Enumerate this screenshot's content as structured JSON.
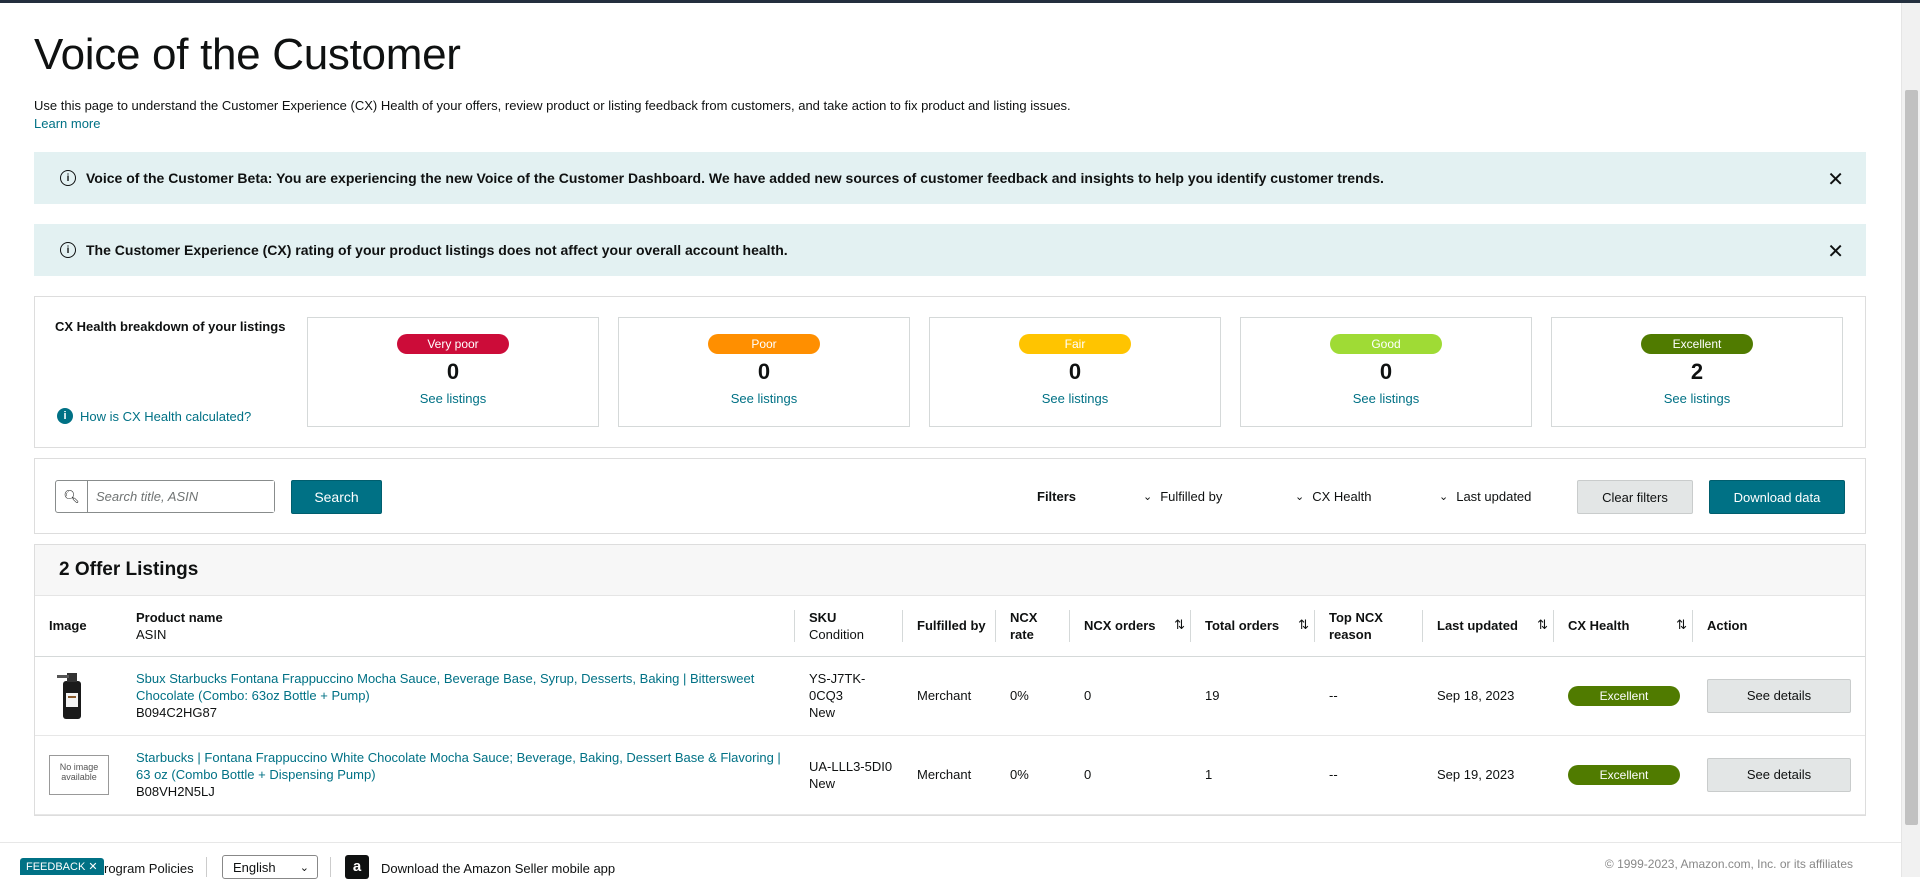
{
  "header": {
    "title": "Voice of the Customer",
    "intro": "Use this page to understand the Customer Experience (CX) Health of your offers, review product or listing feedback from customers, and take action to fix product and listing issues.",
    "learn_more": "Learn more"
  },
  "alerts": [
    {
      "text": "Voice of the Customer Beta: You are experiencing the new Voice of the Customer Dashboard. We have added new sources of customer feedback and insights to help you identify customer trends."
    },
    {
      "text": "The Customer Experience (CX) rating of your product listings does not affect your overall account health."
    }
  ],
  "cx_health": {
    "title": "CX Health breakdown of your listings",
    "help_link": "How is CX Health calculated?",
    "cards": [
      {
        "label": "Very poor",
        "count": "0",
        "link": "See listings",
        "color": "#cc0c39"
      },
      {
        "label": "Poor",
        "count": "0",
        "link": "See listings",
        "color": "#ff8f00"
      },
      {
        "label": "Fair",
        "count": "0",
        "link": "See listings",
        "color": "#ffc400"
      },
      {
        "label": "Good",
        "count": "0",
        "link": "See listings",
        "color": "#9fdb35"
      },
      {
        "label": "Excellent",
        "count": "2",
        "link": "See listings",
        "color": "#507b00"
      }
    ]
  },
  "toolbar": {
    "search_placeholder": "Search title, ASIN",
    "search_button": "Search",
    "filters_label": "Filters",
    "filter_fulfilled": "Fulfilled by",
    "filter_cx": "CX Health",
    "filter_updated": "Last updated",
    "clear_filters": "Clear filters",
    "download": "Download data"
  },
  "listings": {
    "heading": "2 Offer Listings",
    "columns": {
      "image": "Image",
      "product_name": "Product name",
      "asin": "ASIN",
      "sku": "SKU",
      "condition": "Condition",
      "fulfilled_by": "Fulfilled by",
      "ncx_rate": "NCX rate",
      "ncx_orders": "NCX orders",
      "total_orders": "Total orders",
      "top_ncx_1": "Top NCX",
      "top_ncx_2": "reason",
      "last_updated": "Last updated",
      "cx_health": "CX Health",
      "action": "Action"
    },
    "rows": [
      {
        "image_text": "",
        "product_name": "Sbux Starbucks Fontana Frappuccino Mocha Sauce, Beverage Base, Syrup, Desserts, Baking | Bittersweet Chocolate (Combo: 63oz Bottle + Pump)",
        "asin": "B094C2HG87",
        "sku": "YS-J7TK-0CQ3",
        "condition": "New",
        "fulfilled_by": "Merchant",
        "ncx_rate": "0%",
        "ncx_orders": "0",
        "total_orders": "19",
        "top_ncx": "--",
        "last_updated": "Sep 18, 2023",
        "cx_health": "Excellent",
        "action": "See details"
      },
      {
        "image_text": "No image available",
        "product_name": "Starbucks | Fontana Frappuccino White Chocolate Mocha Sauce; Beverage, Baking, Dessert Base & Flavoring | 63 oz (Combo Bottle + Dispensing Pump)",
        "asin": "B08VH2N5LJ",
        "sku": "UA-LLL3-5DI0",
        "condition": "New",
        "fulfilled_by": "Merchant",
        "ncx_rate": "0%",
        "ncx_orders": "0",
        "total_orders": "1",
        "top_ncx": "--",
        "last_updated": "Sep 19, 2023",
        "cx_health": "Excellent",
        "action": "See details"
      }
    ]
  },
  "footer": {
    "feedback": "FEEDBACK",
    "feedback_close": "✕",
    "program_policies": "rogram Policies",
    "language": "English",
    "app_text": "Download the Amazon Seller mobile app",
    "copyright": "© 1999-2023, Amazon.com, Inc. or its affiliates"
  }
}
